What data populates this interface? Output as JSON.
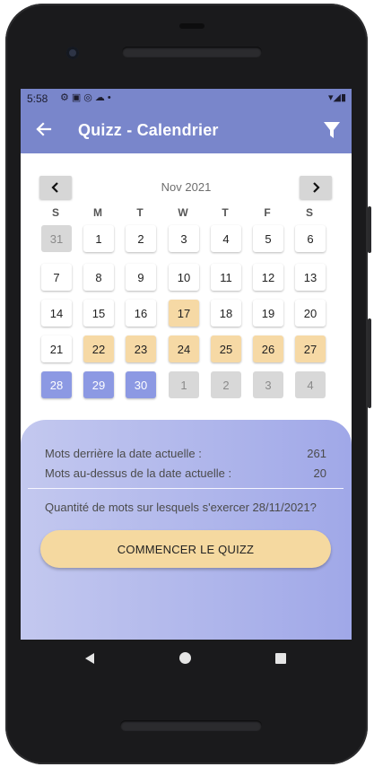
{
  "status": {
    "time": "5:58"
  },
  "appbar": {
    "title": "Quizz - Calendrier"
  },
  "calendar": {
    "month_label": "Nov 2021",
    "weekdays": [
      "S",
      "M",
      "T",
      "W",
      "T",
      "F",
      "S"
    ],
    "weeks": [
      [
        {
          "d": "31",
          "s": "muted"
        },
        {
          "d": "1",
          "s": ""
        },
        {
          "d": "2",
          "s": ""
        },
        {
          "d": "3",
          "s": ""
        },
        {
          "d": "4",
          "s": ""
        },
        {
          "d": "5",
          "s": ""
        },
        {
          "d": "6",
          "s": ""
        }
      ],
      [
        {
          "d": "7",
          "s": ""
        },
        {
          "d": "8",
          "s": ""
        },
        {
          "d": "9",
          "s": ""
        },
        {
          "d": "10",
          "s": ""
        },
        {
          "d": "11",
          "s": ""
        },
        {
          "d": "12",
          "s": ""
        },
        {
          "d": "13",
          "s": ""
        }
      ],
      [
        {
          "d": "14",
          "s": ""
        },
        {
          "d": "15",
          "s": ""
        },
        {
          "d": "16",
          "s": ""
        },
        {
          "d": "17",
          "s": "hi"
        },
        {
          "d": "18",
          "s": ""
        },
        {
          "d": "19",
          "s": ""
        },
        {
          "d": "20",
          "s": ""
        }
      ],
      [
        {
          "d": "21",
          "s": ""
        },
        {
          "d": "22",
          "s": "hi"
        },
        {
          "d": "23",
          "s": "hi"
        },
        {
          "d": "24",
          "s": "hi"
        },
        {
          "d": "25",
          "s": "hi"
        },
        {
          "d": "26",
          "s": "hi"
        },
        {
          "d": "27",
          "s": "hi"
        }
      ],
      [
        {
          "d": "28",
          "s": "sel"
        },
        {
          "d": "29",
          "s": "sel"
        },
        {
          "d": "30",
          "s": "sel"
        },
        {
          "d": "1",
          "s": "muted"
        },
        {
          "d": "2",
          "s": "muted"
        },
        {
          "d": "3",
          "s": "muted"
        },
        {
          "d": "4",
          "s": "muted"
        }
      ]
    ]
  },
  "stats": {
    "before_label": "Mots derrière la date actuelle :",
    "before_value": "261",
    "after_label": "Mots au-dessus de la date actuelle :",
    "after_value": "20",
    "practice_text": "Quantité de mots sur lesquels s'exercer 28/11/2021?",
    "start_button": "COMMENCER LE QUIZZ"
  },
  "colors": {
    "primary": "#7986cb",
    "highlight_day": "#f6d9a5",
    "selected_day": "#8c99e3",
    "muted_day": "#d8d8d8",
    "button": "#f5d9a0"
  }
}
